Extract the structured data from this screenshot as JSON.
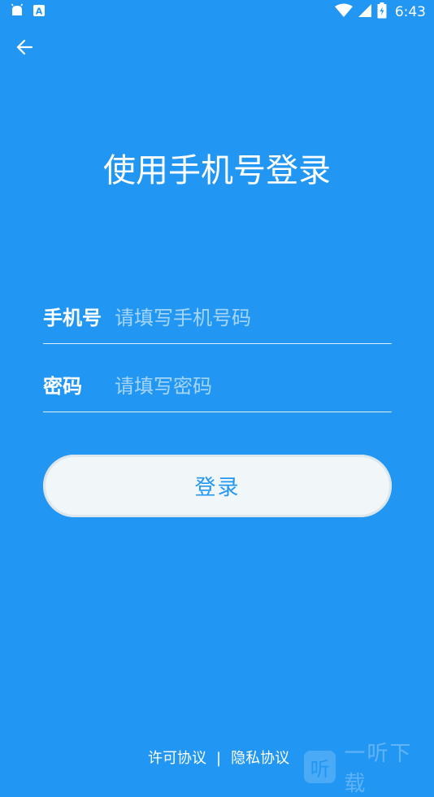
{
  "status_bar": {
    "time": "6:43",
    "left_icons": [
      "android-icon",
      "a-notification-icon"
    ],
    "right_icons": [
      "wifi-icon",
      "signal-icon",
      "battery-icon"
    ]
  },
  "header": {
    "back_icon": "arrow-left-icon"
  },
  "title": "使用手机号登录",
  "form": {
    "phone": {
      "label": "手机号",
      "placeholder": "请填写手机号码",
      "value": ""
    },
    "password": {
      "label": "密码",
      "placeholder": "请填写密码",
      "value": ""
    }
  },
  "login_button": {
    "label": "登录"
  },
  "footer": {
    "license_label": "许可协议",
    "separator": "|",
    "privacy_label": "隐私协议"
  },
  "watermark": {
    "icon_char": "听",
    "text": "一听下载"
  },
  "colors": {
    "background": "#2196F3",
    "button_bg": "#F1F6F9",
    "button_text": "#2196F3"
  }
}
